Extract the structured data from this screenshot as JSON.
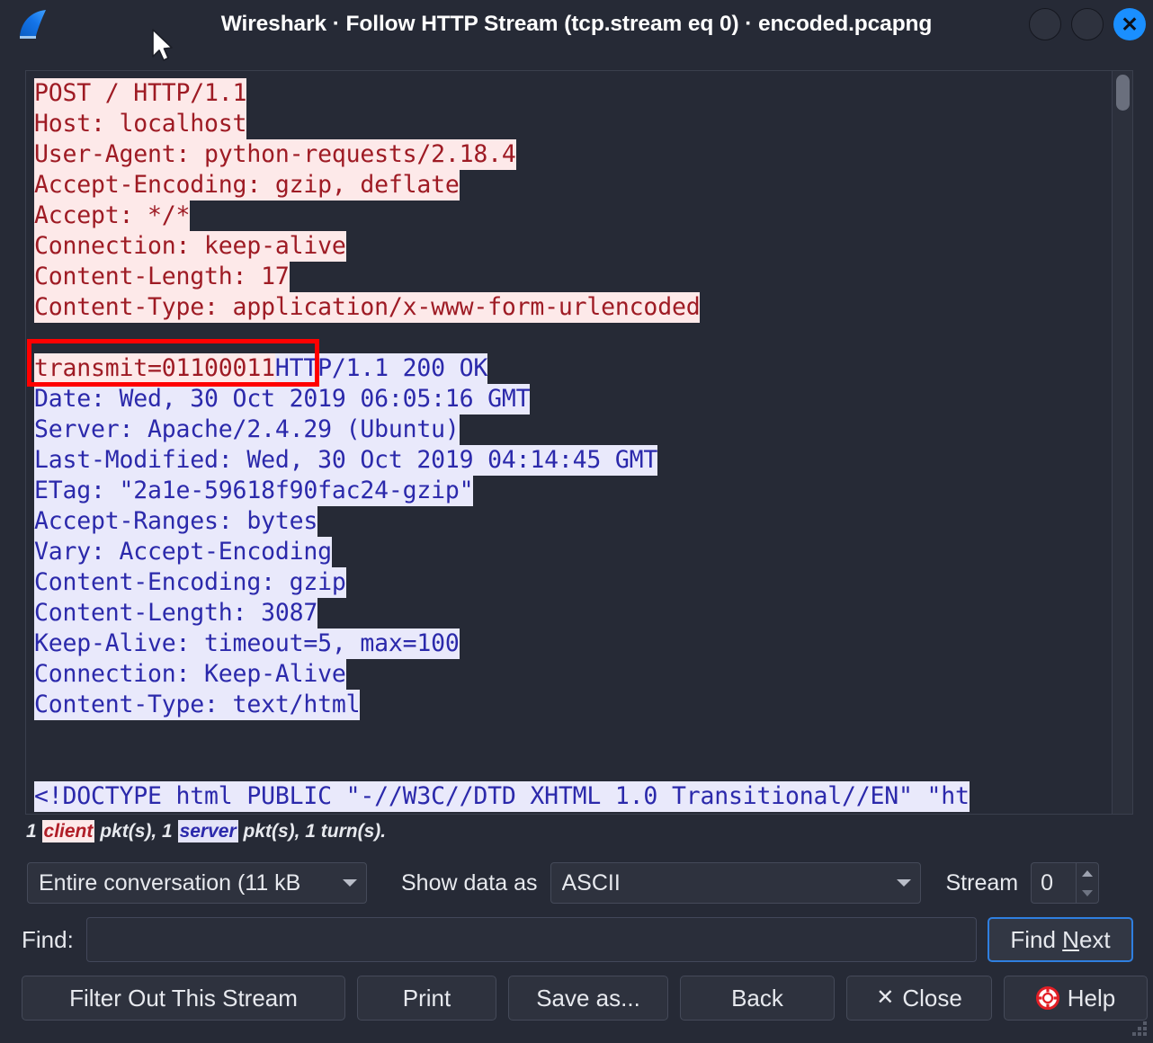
{
  "window": {
    "title": "Wireshark · Follow HTTP Stream (tcp.stream eq 0) · encoded.pcapng",
    "logo_icon": "wireshark-fin-icon",
    "minimize_label": "",
    "maximize_label": "",
    "close_label": "✕",
    "cursor_icon": "mouse-pointer-icon",
    "accent_color": "#1a8fff",
    "background_color": "#262a36"
  },
  "stream": {
    "client_color": "#9e1b24",
    "client_background": "#fde9e9",
    "server_color": "#2b29ab",
    "server_background": "#e9e9fb",
    "annotation_color": "#ff0000",
    "lines": [
      {
        "text": "POST / HTTP/1.1",
        "role": "client"
      },
      {
        "text": "Host: localhost",
        "role": "client"
      },
      {
        "text": "User-Agent: python-requests/2.18.4",
        "role": "client"
      },
      {
        "text": "Accept-Encoding: gzip, deflate",
        "role": "client"
      },
      {
        "text": "Accept: */*",
        "role": "client"
      },
      {
        "text": "Connection: keep-alive",
        "role": "client"
      },
      {
        "text": "Content-Length: 17",
        "role": "client"
      },
      {
        "text": "Content-Type: application/x-www-form-urlencoded",
        "role": "client"
      },
      {
        "text": "",
        "role": "blank"
      },
      {
        "text": "transmit=01100011",
        "role": "client",
        "inline_after": "HTTP/1.1 200 OK",
        "inline_after_role": "server",
        "annotated": true
      },
      {
        "text": "Date: Wed, 30 Oct 2019 06:05:16 GMT",
        "role": "server"
      },
      {
        "text": "Server: Apache/2.4.29 (Ubuntu)",
        "role": "server"
      },
      {
        "text": "Last-Modified: Wed, 30 Oct 2019 04:14:45 GMT",
        "role": "server"
      },
      {
        "text": "ETag: \"2a1e-59618f90fac24-gzip\"",
        "role": "server"
      },
      {
        "text": "Accept-Ranges: bytes",
        "role": "server"
      },
      {
        "text": "Vary: Accept-Encoding",
        "role": "server"
      },
      {
        "text": "Content-Encoding: gzip",
        "role": "server"
      },
      {
        "text": "Content-Length: 3087",
        "role": "server"
      },
      {
        "text": "Keep-Alive: timeout=5, max=100",
        "role": "server"
      },
      {
        "text": "Connection: Keep-Alive",
        "role": "server"
      },
      {
        "text": "Content-Type: text/html",
        "role": "server"
      },
      {
        "text": "",
        "role": "blank"
      },
      {
        "text": "",
        "role": "blank"
      },
      {
        "text": "<!DOCTYPE html PUBLIC \"-//W3C//DTD XHTML 1.0 Transitional//EN\" \"ht",
        "role": "server"
      }
    ],
    "scrollbar": "vertical-scrollbar"
  },
  "status": {
    "prefix": "1 ",
    "client_word": "client",
    "middle": " pkt(s), 1 ",
    "server_word": "server",
    "suffix": " pkt(s), 1 turn(s)."
  },
  "controls": {
    "conversation_value": "Entire conversation (11 kB",
    "show_data_as_label": "Show data as",
    "show_data_as_value": "ASCII",
    "stream_label": "Stream",
    "stream_value": "0"
  },
  "find": {
    "label": "Find:",
    "value": "",
    "placeholder": "",
    "button_prefix": "Find ",
    "button_accel": "N",
    "button_suffix": "ext"
  },
  "buttons": {
    "filter_out": "Filter Out This Stream",
    "print": "Print",
    "save_as": "Save as...",
    "back": "Back",
    "close_glyph": "✕",
    "close": "Close",
    "help": "Help",
    "help_icon": "lifebuoy-icon"
  }
}
